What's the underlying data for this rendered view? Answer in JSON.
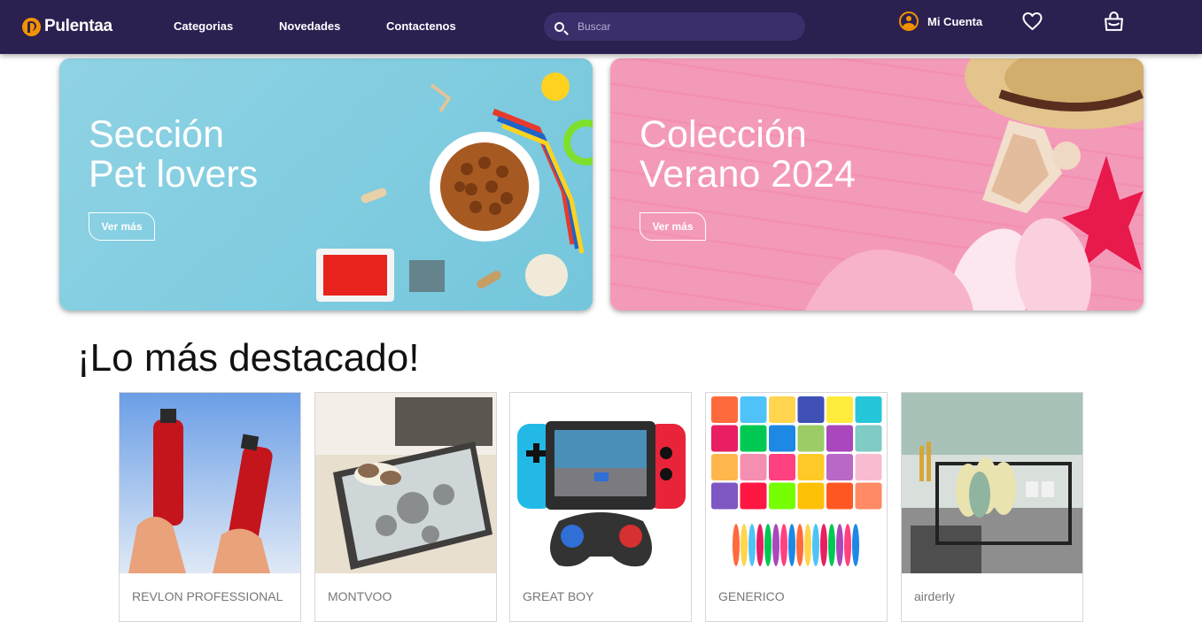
{
  "header": {
    "logo_text": "Pulentaa",
    "nav": [
      "Categorias",
      "Novedades",
      "Contactenos"
    ],
    "search_placeholder": "Buscar",
    "account_label": "Mi Cuenta",
    "icons": [
      "search-icon",
      "user-icon",
      "heart-icon",
      "cart-icon"
    ]
  },
  "banners": [
    {
      "title": "Sección\nPet lovers",
      "button": "Ver más"
    },
    {
      "title": "Colección\nVerano 2024",
      "button": "Ver más"
    }
  ],
  "featured": {
    "title": "¡Lo más destacado!",
    "products": [
      {
        "brand": "REVLON PROFESSIONAL"
      },
      {
        "brand": "MONTVOO"
      },
      {
        "brand": "GREAT BOY"
      },
      {
        "brand": "GENERICO"
      },
      {
        "brand": "airderly"
      }
    ]
  },
  "colors": {
    "navbar": "#2b2050",
    "accent": "#f39200",
    "pets_banner": "#7ccbe0",
    "summer_banner": "#f49ab9"
  }
}
